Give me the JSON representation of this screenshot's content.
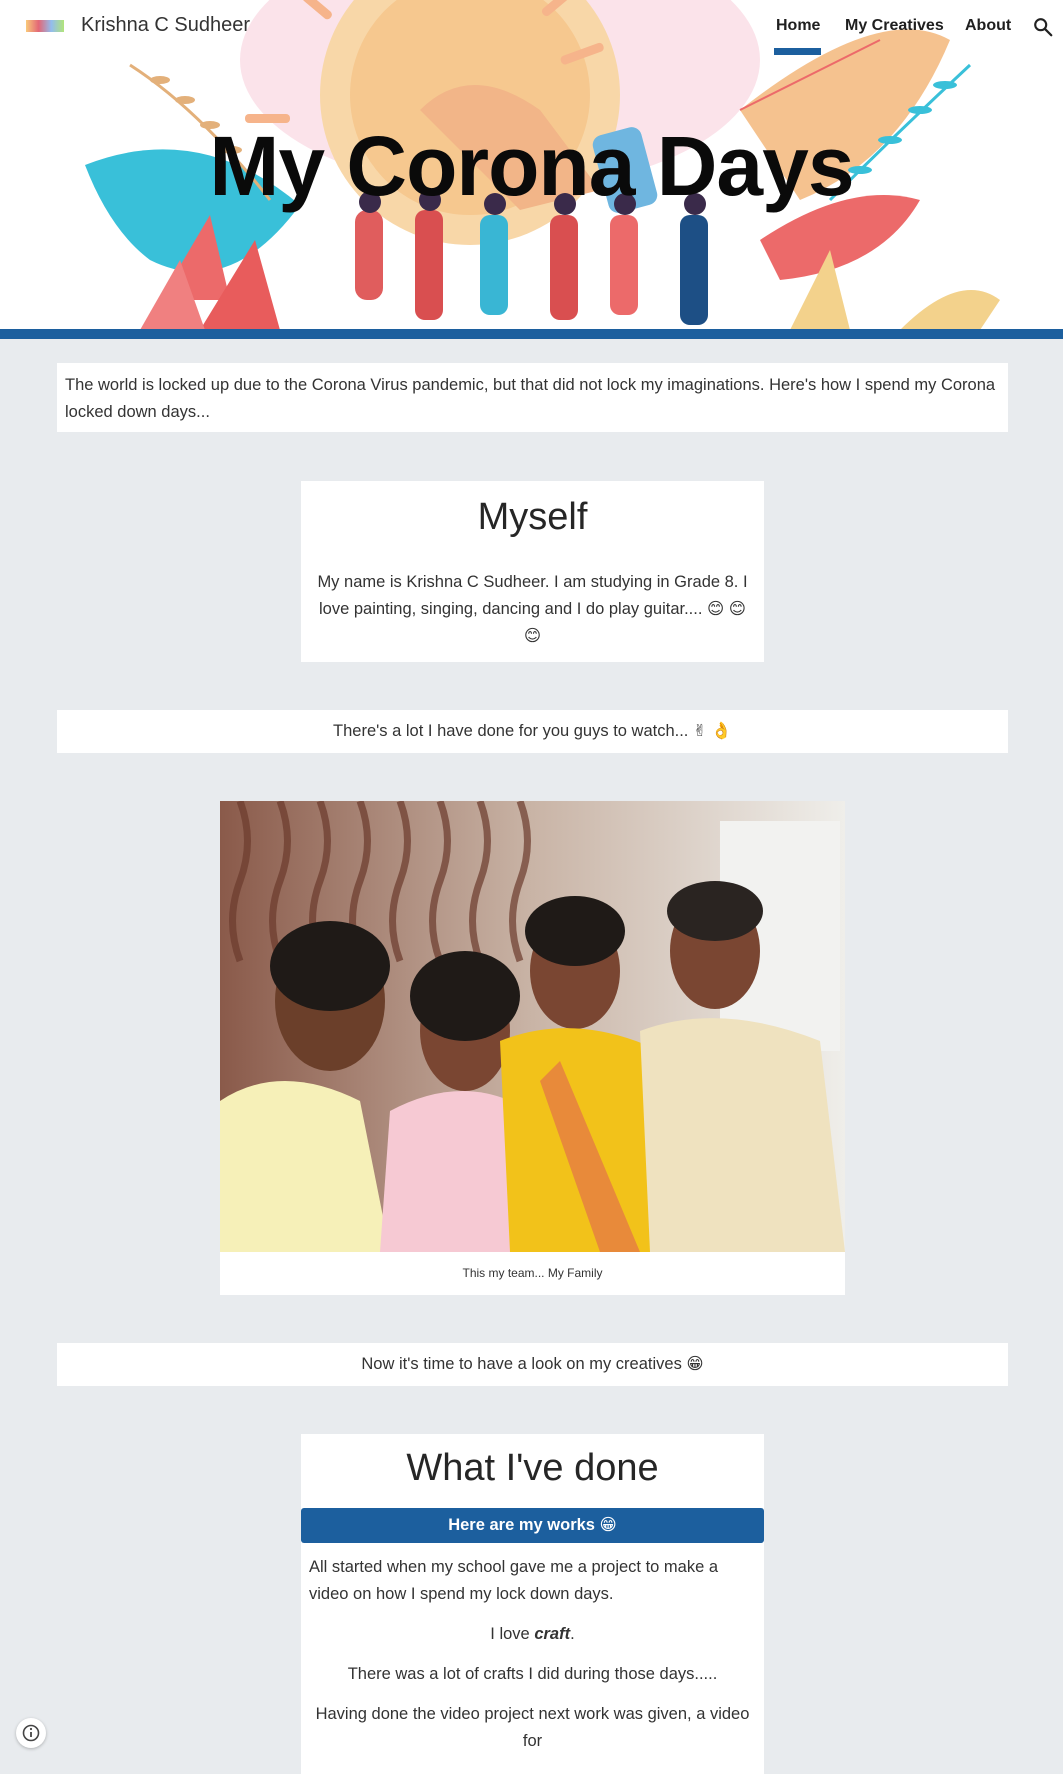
{
  "header": {
    "logo_text": "Krishna C Sudheer logo",
    "site_title": "Krishna C Sudheer",
    "nav": [
      {
        "label": "Home",
        "active": true
      },
      {
        "label": "My Creatives",
        "active": false
      },
      {
        "label": "About",
        "active": false
      }
    ],
    "search_icon": "search-icon",
    "hero_title": "My Corona Days"
  },
  "intro": {
    "text": " The world is locked up due to the Corona Virus pandemic, but that did not lock my imaginations. Here's how I spend my Corona locked down days..."
  },
  "myself": {
    "heading": "Myself",
    "text": "My name is Krishna C Sudheer. I am studying in Grade 8. I love painting, singing, dancing and I do play guitar.... 😊 😊 😊"
  },
  "watch": {
    "text": "There's a lot I have done for you guys to watch...  ✌ 👌"
  },
  "family_photo": {
    "caption": "This my team... My Family"
  },
  "creatives_intro": {
    "text": "Now it's time to have a look on my creatives 😁"
  },
  "done": {
    "heading": "What I've done",
    "button_label": "Here are my works 😁",
    "p1": "All started when my school gave me a project to make a video on how I spend my lock down days.",
    "p2_prefix": "I love ",
    "p2_emph": "craft",
    "p2_suffix": ".",
    "p3": "There was a lot of crafts I did during those days.....",
    "p4": "Having done the video project next work was given, a video for"
  },
  "colors": {
    "accent": "#1c5f9e",
    "page_bg": "#e8ebee",
    "card_bg": "#ffffff"
  },
  "info_button": {
    "icon": "info-icon"
  }
}
